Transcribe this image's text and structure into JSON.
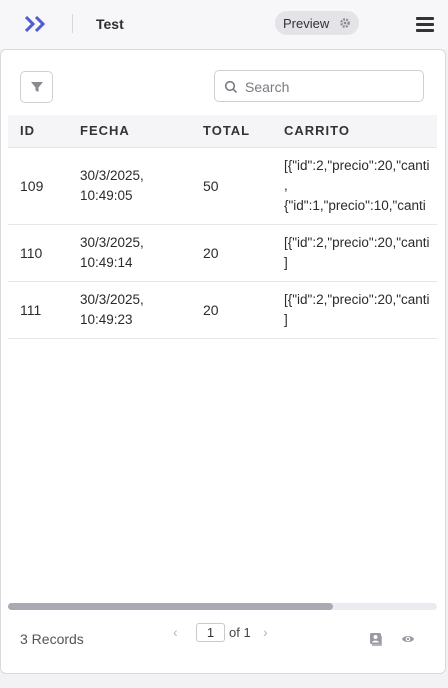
{
  "header": {
    "app_title": "Test",
    "preview_label": "Preview",
    "logo_icon": "double-chevron-logo-icon",
    "menu_icon": "hamburger-menu-icon"
  },
  "toolbar": {
    "filter_icon": "filter-icon",
    "search": {
      "placeholder": "Search",
      "value": ""
    }
  },
  "table": {
    "columns": [
      "ID",
      "FECHA",
      "TOTAL",
      "CARRITO"
    ],
    "rows": [
      {
        "id": "109",
        "fecha": "30/3/2025,\n10:49:05",
        "total": "50",
        "carrito": "[{\"id\":2,\"precio\":20,\"canti\n,\n{\"id\":1,\"precio\":10,\"canti"
      },
      {
        "id": "110",
        "fecha": "30/3/2025,\n10:49:14",
        "total": "20",
        "carrito": "[{\"id\":2,\"precio\":20,\"canti\n]"
      },
      {
        "id": "111",
        "fecha": "30/3/2025,\n10:49:23",
        "total": "20",
        "carrito": "[{\"id\":2,\"precio\":20,\"canti\n]"
      }
    ]
  },
  "footer": {
    "records_label": "3 Records",
    "prev_symbol": "‹",
    "next_symbol": "›",
    "current_page": "1",
    "page_total_label": "of 1",
    "icons": [
      "export-contact-icon",
      "eye-icon"
    ]
  },
  "colors": {
    "accent": "#4f5bd5",
    "background": "#f2f2f5",
    "scroll_thumb": "#a9a9b1"
  }
}
